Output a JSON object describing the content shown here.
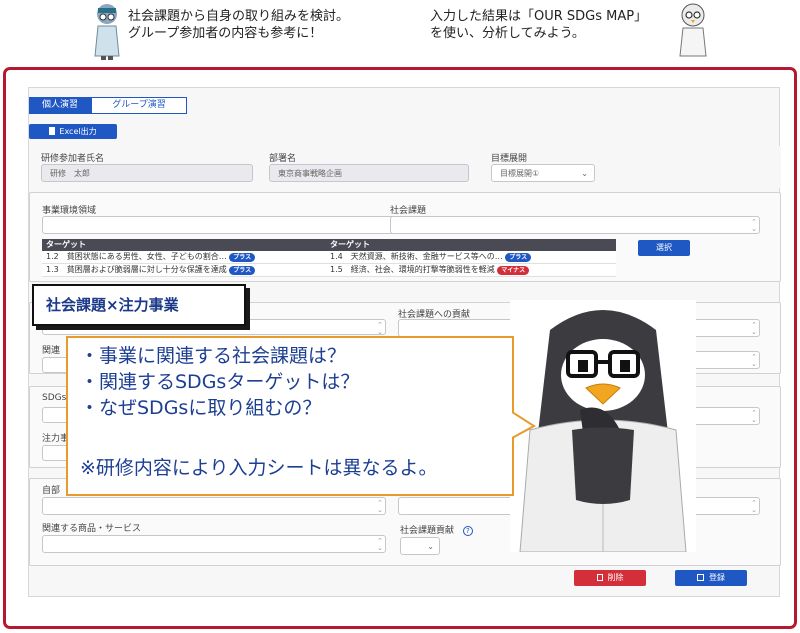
{
  "speech_left": {
    "line1": "社会課題から自身の取り組みを検討。",
    "line2": "グループ参加者の内容も参考に！"
  },
  "speech_right": {
    "line1": "入力した結果は「OUR SDGs MAP」",
    "line2": "を使い、分析してみよう。"
  },
  "tabs": [
    "個人演習",
    "グループ演習"
  ],
  "excel_button": "Excel出力",
  "participant_label": "研修参加者氏名",
  "participant_value": "研修　太郎",
  "department_label": "部署名",
  "department_value": "東京商事戦略企画",
  "goal_label": "目標展開",
  "goal_value": "目標展開①",
  "business_area_label": "事業環境領域",
  "social_issue_label": "社会課題",
  "target_headers": [
    "ターゲット",
    "ターゲット"
  ],
  "target_rows": [
    {
      "left": "1.2　貧困状態にある男性、女性、子どもの割合…",
      "left_tag": "プラス",
      "right": "1.4　天然資源、新技術、金融サービス等への…",
      "right_tag": "プラス"
    },
    {
      "left": "1.3　貧困層および脆弱層に対し十分な保護を達成",
      "left_tag": "プラス",
      "right": "1.5　経済、社会、環境的打撃等脆弱性を軽減",
      "right_tag": "マイナス"
    }
  ],
  "select_button": "選択",
  "callout_title": "社会課題×注力事業",
  "contribution_label": "社会課題への貢献",
  "partial_labels": {
    "related": "関連",
    "sdgs": "SDGs",
    "focus": "注力事",
    "own": "自部"
  },
  "bubble_lines": [
    "・事業に関連する社会課題は？",
    "・関連するSDGsターゲットは？",
    "・なぜSDGsに取り組むの？",
    "※研修内容により入力シートは異なるよ。"
  ],
  "products_label": "関連する商品・サービス",
  "contribution2_label": "社会課題貢献",
  "delete_button": "削除",
  "save_button": "登録",
  "colors": {
    "frame": "#b5182f",
    "primary": "#1f57c3",
    "danger": "#d32f3a",
    "bubble_border": "#e89a2a",
    "bubble_text": "#1d3f93"
  }
}
